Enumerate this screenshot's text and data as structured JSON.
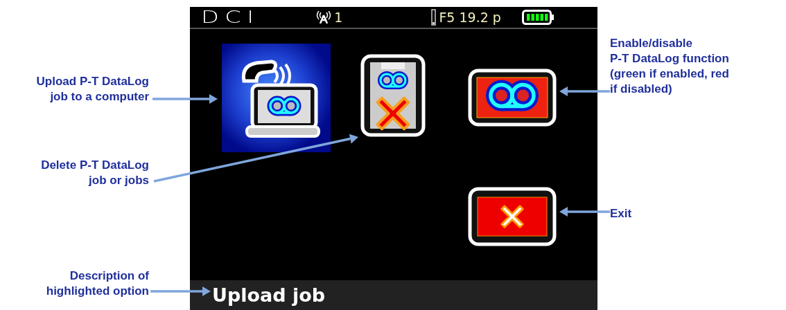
{
  "left_callouts": [
    {
      "lines": [
        "Upload P-T DataLog",
        "job to a computer"
      ]
    },
    {
      "lines": [
        "Delete P-T DataLog",
        "job or jobs"
      ]
    },
    {
      "lines": [
        "Description of",
        "highlighted option"
      ]
    }
  ],
  "screen": {
    "status_bar": {
      "logo": "DCI",
      "channel": "1",
      "frequency": "F5 19.2 p"
    },
    "menu_items": [
      {
        "kind": "upload",
        "selected": true
      },
      {
        "kind": "delete",
        "selected": false
      },
      {
        "kind": "toggle",
        "selected": false,
        "enabled": false
      },
      {
        "kind": "exit",
        "selected": false
      }
    ],
    "description": "Upload job"
  },
  "right_callouts": [
    {
      "lines": [
        "Enable/disable",
        "P-T DataLog function",
        "(green if enabled, red",
        "if disabled)"
      ]
    },
    {
      "lines": [
        "Exit"
      ]
    }
  ]
}
